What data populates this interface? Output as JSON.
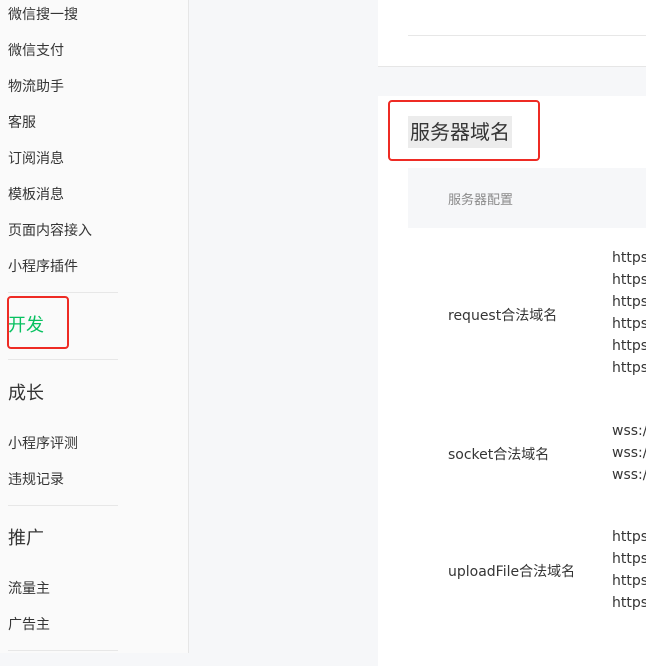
{
  "sidebar": {
    "items_top": [
      "微信搜一搜",
      "微信支付",
      "物流助手",
      "客服",
      "订阅消息",
      "模板消息",
      "页面内容接入",
      "小程序插件"
    ],
    "dev_heading": "开发",
    "growth_heading": "成长",
    "growth_items": [
      "小程序评测",
      "违规记录"
    ],
    "promo_heading": "推广",
    "promo_items": [
      "流量主",
      "广告主"
    ],
    "active_color": "#07c160"
  },
  "main": {
    "section_title": "服务器域名",
    "table_header": "服务器配置",
    "rows": [
      {
        "label": "request合法域名",
        "values": [
          "https:",
          "https:",
          "https:",
          "https:",
          "https:",
          "https:"
        ]
      },
      {
        "label": "socket合法域名",
        "values": [
          "wss://",
          "wss://",
          "wss://"
        ]
      },
      {
        "label": "uploadFile合法域名",
        "values": [
          "https:",
          "https:",
          "https:",
          "https:"
        ]
      }
    ]
  },
  "highlight_color": "#ee2b24"
}
